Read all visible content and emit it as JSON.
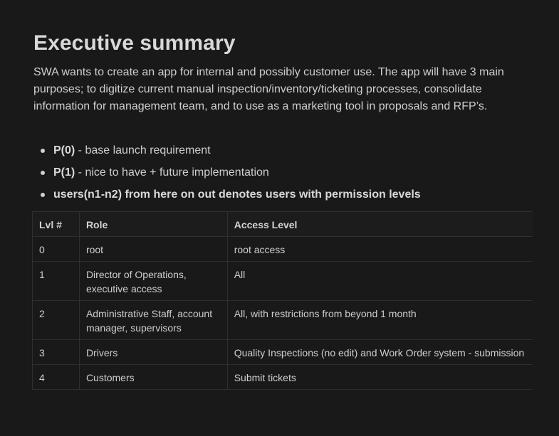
{
  "doc": {
    "heading": "Executive summary",
    "intro": "SWA wants to create an app for internal and possibly customer use. The app will have 3 main purposes; to digitize current manual inspection/inventory/ticketing processes, consolidate information for management team, and to use as a marketing tool in proposals and RFP’s.",
    "bullets": [
      {
        "bold": "P(0)",
        "text": " - base launch requirement"
      },
      {
        "bold": "P(1)",
        "text": " -  nice to have + future implementation"
      },
      {
        "bold": "users(n1-n2) from here on out denotes users with permission levels",
        "text": ""
      }
    ]
  },
  "table": {
    "headers": [
      "Lvl #",
      "Role",
      "Access Level"
    ],
    "rows": [
      {
        "lvl": "0",
        "role": "root",
        "access": "root access"
      },
      {
        "lvl": "1",
        "role": "Director of Operations, executive access",
        "access": "All"
      },
      {
        "lvl": "2",
        "role": "Administrative Staff, account manager, supervisors",
        "access": "All, with restrictions from beyond 1 month"
      },
      {
        "lvl": "3",
        "role": "Drivers",
        "access": "Quality Inspections (no edit) and Work Order system - submission"
      },
      {
        "lvl": "4",
        "role": "Customers",
        "access": "Submit tickets"
      }
    ]
  }
}
